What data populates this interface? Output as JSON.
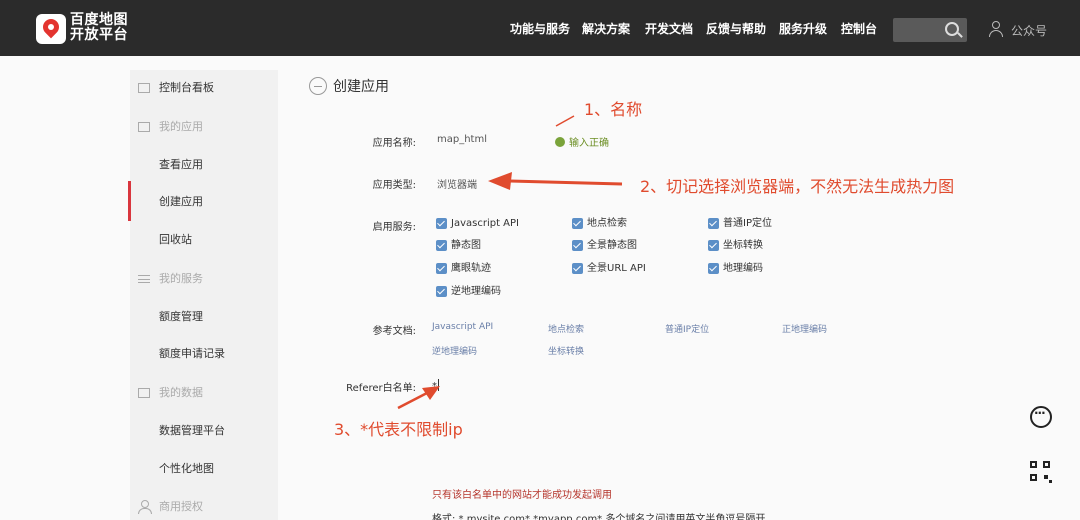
{
  "header": {
    "brand_line1": "百度地图",
    "brand_line2": "开放平台",
    "nav": [
      "功能与服务",
      "解决方案",
      "开发文档",
      "反馈与帮助",
      "服务升级",
      "控制台"
    ],
    "user_label": "公众号"
  },
  "sidebar": {
    "items": [
      {
        "label": "控制台看板",
        "type": "item"
      },
      {
        "label": "我的应用",
        "type": "group"
      },
      {
        "label": "查看应用",
        "type": "item"
      },
      {
        "label": "创建应用",
        "type": "item",
        "active": true
      },
      {
        "label": "回收站",
        "type": "item"
      },
      {
        "label": "我的服务",
        "type": "group"
      },
      {
        "label": "额度管理",
        "type": "item"
      },
      {
        "label": "额度申请记录",
        "type": "item"
      },
      {
        "label": "我的数据",
        "type": "group"
      },
      {
        "label": "数据管理平台",
        "type": "item"
      },
      {
        "label": "个性化地图",
        "type": "item"
      },
      {
        "label": "商用授权",
        "type": "group"
      }
    ]
  },
  "main": {
    "title": "创建应用",
    "app_name_label": "应用名称:",
    "app_name_value": "map_html",
    "app_name_status": "输入正确",
    "app_type_label": "应用类型:",
    "app_type_value": "浏览器端",
    "services_label": "启用服务:",
    "services": [
      "Javascript API",
      "地点检索",
      "普通IP定位",
      "静态图",
      "全景静态图",
      "坐标转换",
      "鹰眼轨迹",
      "全景URL API",
      "地理编码",
      "逆地理编码"
    ],
    "docs_label": "参考文档:",
    "docs": [
      "Javascript API",
      "地点检索",
      "普通IP定位",
      "正地理编码",
      "逆地理编码",
      "坐标转换"
    ],
    "referer_label": "Referer白名单:",
    "referer_value": "*",
    "hint_red": "只有该白名单中的网站才能成功发起调用",
    "hint_format": "格式: *.mysite.com* *myapp.com* 多个域名之间请用英文半角逗号隔开"
  },
  "annotations": {
    "a1": "1、名称",
    "a2": "2、切记选择浏览器端，不然无法生成热力图",
    "a3": "3、*代表不限制ip"
  },
  "colors": {
    "topbar": "#2b2b2b",
    "accent_red": "#d9363e",
    "annotation": "#e04b2e",
    "checkbox": "#5c8fc7"
  }
}
